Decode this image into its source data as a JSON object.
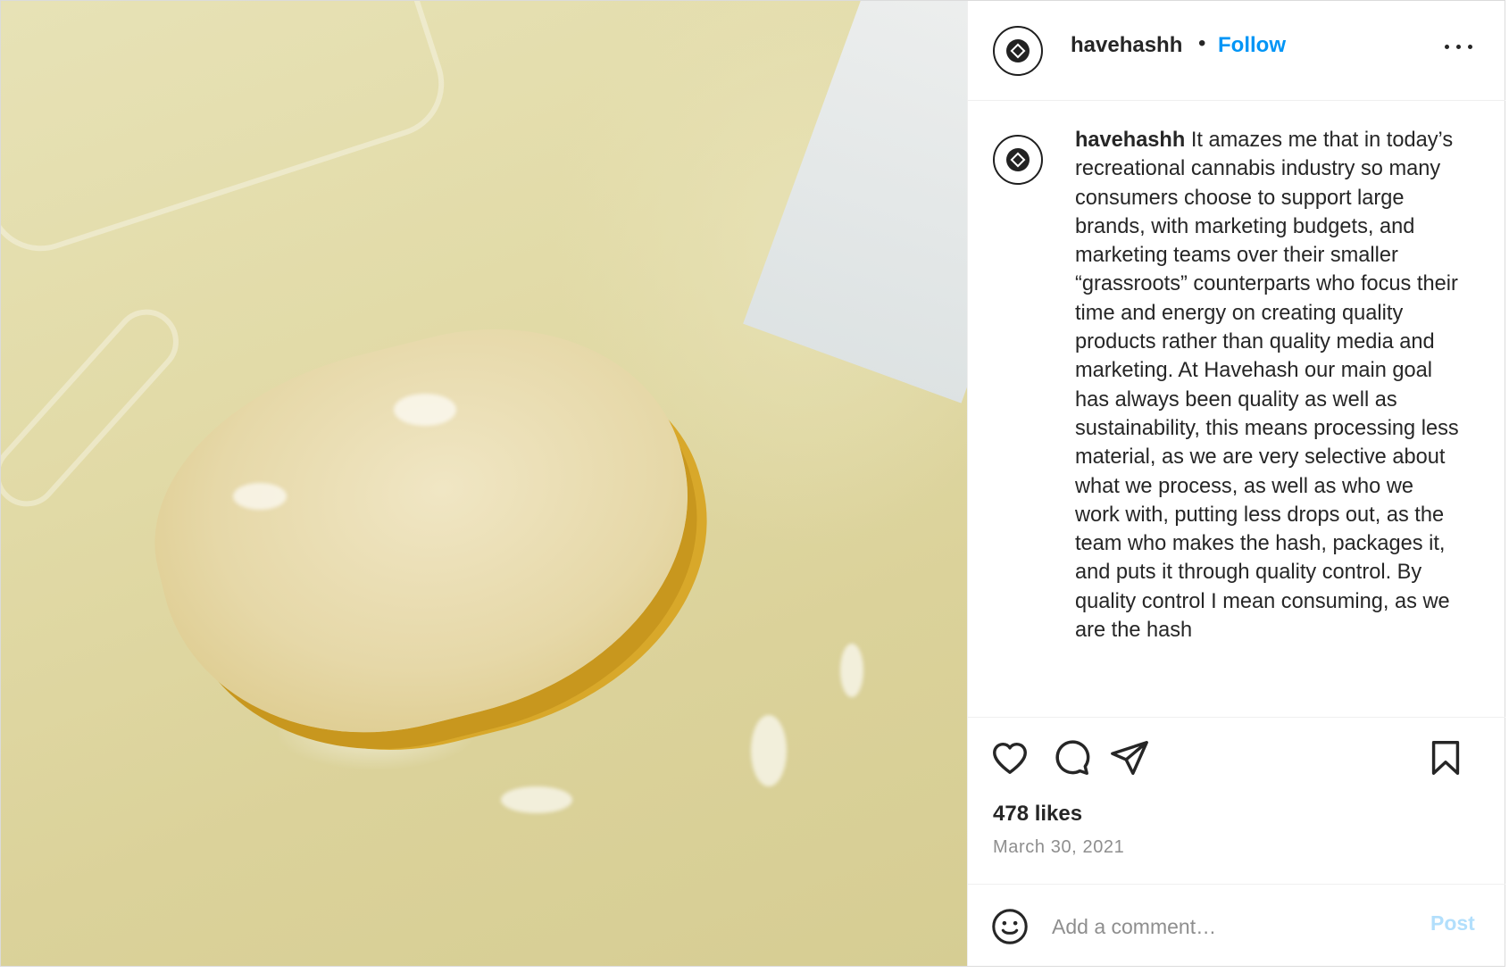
{
  "post": {
    "author": {
      "username": "havehashh",
      "avatar_icon": "have-hash-logo-icon",
      "follow_label": "Follow",
      "separator": "•"
    },
    "caption": {
      "username": "havehashh",
      "text": " It amazes me that in today’s recreational cannabis industry so many consumers choose to support large brands, with marketing budgets, and marketing teams over their smaller “grassroots” counterparts who focus their time and energy on creating quality products rather than quality media and marketing. At Havehash our main goal has always been quality as well as sustainability, this means processing less material, as we are very selective about what we process, as well as who we work with, putting less drops out, as the team who makes the hash, packages it, and puts it through quality control. By quality control I mean consuming, as we are the hash"
    },
    "actions": {
      "like_icon": "heart-icon",
      "comment_icon": "comment-bubble-icon",
      "share_icon": "paper-plane-icon",
      "save_icon": "bookmark-icon",
      "more_icon": "more-options-icon"
    },
    "likes": "478 likes",
    "date": "March 30, 2021",
    "comment_box": {
      "emoji_icon": "smiley-icon",
      "placeholder": "Add a comment…",
      "post_label": "Post"
    },
    "colors": {
      "follow": "#0095f6",
      "post_disabled": "#b2dffc",
      "text": "#262626",
      "muted": "#8e8e8e"
    }
  }
}
